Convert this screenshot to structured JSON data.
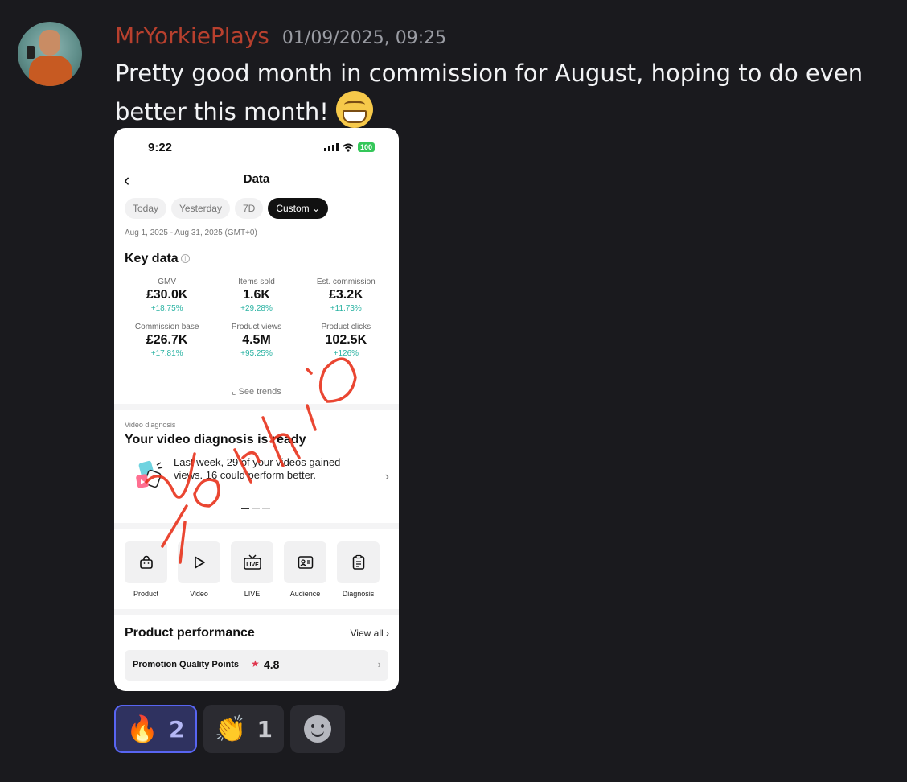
{
  "message": {
    "username": "MrYorkiePlays",
    "timestamp": "01/09/2025, 09:25",
    "text": "Pretty good month in commission for August, hoping to do even better this month!",
    "emoji": "grinning-face"
  },
  "phone": {
    "status": {
      "time": "9:22",
      "battery": "100"
    },
    "nav_title": "Data",
    "chips": [
      "Today",
      "Yesterday",
      "7D",
      "Custom"
    ],
    "custom_chevron": "⌄",
    "date_range": "Aug 1, 2025 - Aug 31, 2025 (GMT+0)",
    "key_data": {
      "title": "Key data",
      "metrics": [
        {
          "label": "GMV",
          "value": "£30.0K",
          "delta": "+18.75%"
        },
        {
          "label": "Items sold",
          "value": "1.6K",
          "delta": "+29.28%"
        },
        {
          "label": "Est. commission",
          "value": "£3.2K",
          "delta": "+11.73%"
        },
        {
          "label": "Commission base",
          "value": "£26.7K",
          "delta": "+17.81%"
        },
        {
          "label": "Product views",
          "value": "4.5M",
          "delta": "+95.25%"
        },
        {
          "label": "Product clicks",
          "value": "102.5K",
          "delta": "+126%"
        }
      ],
      "trends_label": "See trends"
    },
    "video_diagnosis": {
      "small_label": "Video diagnosis",
      "title": "Your video diagnosis is ready",
      "text": "Last week, 29 of your videos gained views. 16 could perform better."
    },
    "tools": [
      {
        "label": "Product",
        "icon": "bag-icon"
      },
      {
        "label": "Video",
        "icon": "play-icon"
      },
      {
        "label": "LIVE",
        "icon": "live-icon"
      },
      {
        "label": "Audience",
        "icon": "id-card-icon"
      },
      {
        "label": "Diagnosis",
        "icon": "clipboard-icon"
      }
    ],
    "product_performance": {
      "title": "Product performance",
      "view_all": "View all",
      "pqp_label": "Promotion Quality Points",
      "pqp_value": "4.8"
    },
    "watermark": "Yorkie"
  },
  "reactions": [
    {
      "emoji": "🔥",
      "count": "2",
      "selected": true
    },
    {
      "emoji": "👏",
      "count": "1",
      "selected": false
    }
  ],
  "colors": {
    "background": "#1a1a1e",
    "username": "#b8402e",
    "delta": "#2bb3a3",
    "watermark": "#e8331c",
    "reaction_selected_border": "#5865f2"
  }
}
